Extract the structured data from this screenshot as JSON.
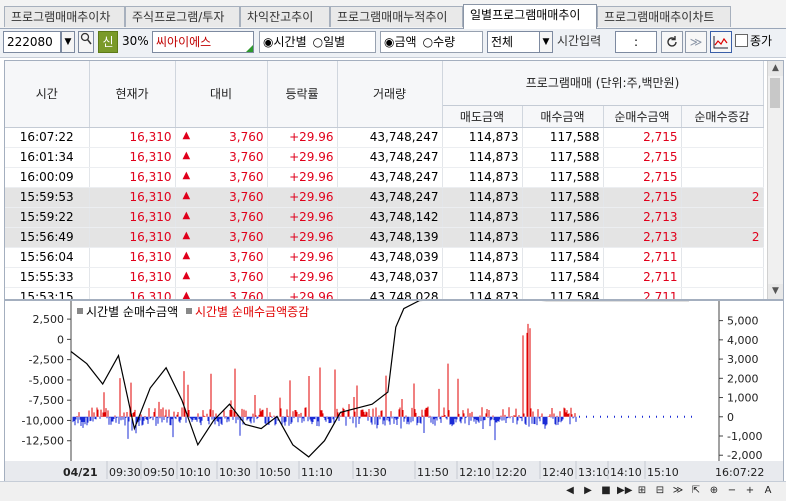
{
  "tabs": [
    {
      "label": "프로그램매매추이차"
    },
    {
      "label": "주식프로그램/투자"
    },
    {
      "label": "차익잔고추이"
    },
    {
      "label": "프로그램매매누적추이"
    },
    {
      "label": "일별프로그램매매추이"
    },
    {
      "label": "프로그램매매추이차트"
    }
  ],
  "toolbar": {
    "stock_code": "222080",
    "credit_badge": "신",
    "margin_rate": "30%",
    "stock_name": "씨아이에스",
    "view_mode": {
      "options": [
        "시간별",
        "일별"
      ],
      "selected": "시간별"
    },
    "unit_mode": {
      "options": [
        "금액",
        "수량"
      ],
      "selected": "금액"
    },
    "market_select": "전체",
    "time_input_label": "시간입력",
    "time_input_value": ":",
    "close_price_label": "종가"
  },
  "table": {
    "headers": [
      "시간",
      "현재가",
      "대비",
      "등락률",
      "거래량"
    ],
    "program_header": "프로그램매매 (단위:주,백만원)",
    "program_subheaders": [
      "매도금액",
      "매수금액",
      "순매수금액",
      "순매수증감"
    ],
    "rows": [
      {
        "time": "16:07:22",
        "price": "16,310",
        "change": "3,760",
        "rate": "+29.96",
        "volume": "43,748,247",
        "sell": "114,873",
        "buy": "117,588",
        "net": "2,715",
        "delta": "",
        "hl": false
      },
      {
        "time": "16:01:34",
        "price": "16,310",
        "change": "3,760",
        "rate": "+29.96",
        "volume": "43,748,247",
        "sell": "114,873",
        "buy": "117,588",
        "net": "2,715",
        "delta": "",
        "hl": false
      },
      {
        "time": "16:00:09",
        "price": "16,310",
        "change": "3,760",
        "rate": "+29.96",
        "volume": "43,748,247",
        "sell": "114,873",
        "buy": "117,588",
        "net": "2,715",
        "delta": "",
        "hl": false
      },
      {
        "time": "15:59:53",
        "price": "16,310",
        "change": "3,760",
        "rate": "+29.96",
        "volume": "43,748,247",
        "sell": "114,873",
        "buy": "117,588",
        "net": "2,715",
        "delta": "2",
        "hl": true
      },
      {
        "time": "15:59:22",
        "price": "16,310",
        "change": "3,760",
        "rate": "+29.96",
        "volume": "43,748,142",
        "sell": "114,873",
        "buy": "117,586",
        "net": "2,713",
        "delta": "",
        "hl": true
      },
      {
        "time": "15:56:49",
        "price": "16,310",
        "change": "3,760",
        "rate": "+29.96",
        "volume": "43,748,139",
        "sell": "114,873",
        "buy": "117,586",
        "net": "2,713",
        "delta": "2",
        "hl": true
      },
      {
        "time": "15:56:04",
        "price": "16,310",
        "change": "3,760",
        "rate": "+29.96",
        "volume": "43,748,039",
        "sell": "114,873",
        "buy": "117,584",
        "net": "2,711",
        "delta": "",
        "hl": false
      },
      {
        "time": "15:55:33",
        "price": "16,310",
        "change": "3,760",
        "rate": "+29.96",
        "volume": "43,748,037",
        "sell": "114,873",
        "buy": "117,584",
        "net": "2,711",
        "delta": "",
        "hl": false
      },
      {
        "time": "15:53:15",
        "price": "16,310",
        "change": "3,760",
        "rate": "+29.96",
        "volume": "43,748,028",
        "sell": "114,873",
        "buy": "117,584",
        "net": "2,711",
        "delta": "",
        "hl": false
      }
    ]
  },
  "chart_data": {
    "type": "line",
    "series": [
      {
        "name": "시간별 순매수금액",
        "color": "#000000",
        "axis": "left",
        "x": [
          "09:00",
          "09:10",
          "09:20",
          "09:30",
          "09:40",
          "09:50",
          "10:00",
          "10:10",
          "10:20",
          "10:30",
          "10:40",
          "10:50",
          "11:00",
          "11:10",
          "11:20",
          "11:30",
          "11:40",
          "11:50",
          "12:00",
          "12:10",
          "12:20",
          "12:25",
          "12:30",
          "12:40",
          "13:00",
          "13:30",
          "14:00",
          "14:30",
          "15:00",
          "15:20"
        ],
        "y": [
          -1500,
          -3000,
          -5500,
          -2000,
          -11000,
          -6000,
          -3500,
          -7500,
          -13000,
          -10000,
          -8000,
          -10500,
          -11000,
          -9500,
          -13000,
          -14500,
          -12500,
          -9000,
          -8500,
          -8000,
          -6500,
          1500,
          3800,
          4800,
          4900,
          4900,
          4800,
          4800,
          4800,
          4800
        ]
      },
      {
        "name": "시간별 순매수금액증감",
        "color": "#e00000",
        "axis": "right"
      }
    ],
    "left_ticks": [
      "2,500",
      "0",
      "-2,500",
      "-5,000",
      "-7,500",
      "-10,000",
      "-12,500"
    ],
    "right_ticks": [
      "5,000",
      "4,000",
      "3,000",
      "2,000",
      "1,000",
      "0",
      "-1,000",
      "-2,000"
    ],
    "x_labels": [
      "04/21",
      "09:30",
      "09:50",
      "10:10",
      "10:30",
      "10:50",
      "11:10",
      "11:30",
      "11:50",
      "12:10",
      "12:20",
      "12:40",
      "13:10",
      "14:10",
      "15:10",
      "16:07:22"
    ],
    "ylim_left": [
      -15000,
      3500
    ],
    "ylim_right": [
      -2300,
      5500
    ]
  },
  "nav": {
    "buttons": [
      "◀",
      "▶",
      "■",
      "▶▶",
      "⊞",
      "⊟",
      "≫",
      "⇱",
      "⊕",
      "−",
      "+",
      "A"
    ]
  }
}
